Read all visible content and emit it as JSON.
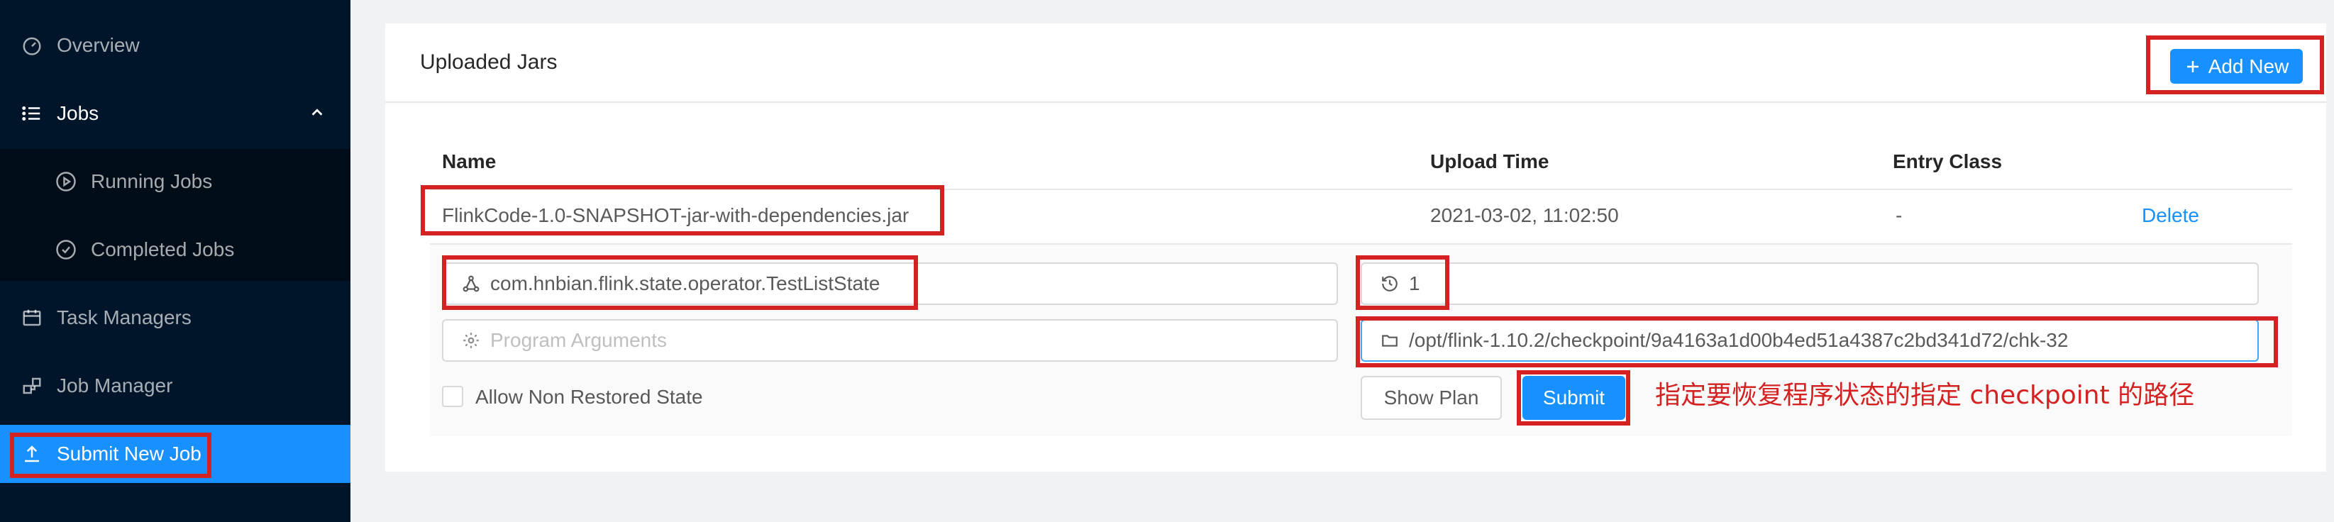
{
  "sidebar": {
    "items": [
      {
        "label": "Overview",
        "icon": "dashboard-icon"
      },
      {
        "label": "Jobs",
        "icon": "list-icon"
      },
      {
        "label": "Running Jobs",
        "icon": "play-circle-icon"
      },
      {
        "label": "Completed Jobs",
        "icon": "check-circle-icon"
      },
      {
        "label": "Task Managers",
        "icon": "schedule-icon"
      },
      {
        "label": "Job Manager",
        "icon": "build-icon"
      },
      {
        "label": "Submit New Job",
        "icon": "upload-icon"
      }
    ],
    "colors": {
      "bg": "#001529",
      "active": "#1890ff"
    }
  },
  "card": {
    "title": "Uploaded Jars",
    "add_label": "Add New"
  },
  "table": {
    "headers": [
      "Name",
      "Upload Time",
      "Entry Class"
    ],
    "rows": [
      {
        "name": "FlinkCode-1.0-SNAPSHOT-jar-with-dependencies.jar",
        "upload_time": "2021-03-02, 11:02:50",
        "entry_class": "-",
        "action": "Delete"
      }
    ]
  },
  "form": {
    "entry_class": "com.hnbian.flink.state.operator.TestListState",
    "parallelism": "1",
    "program_args_placeholder": "Program Arguments",
    "savepoint_path": "/opt/flink-1.10.2/checkpoint/9a4163a1d00b4ed51a4387c2bd341d72/chk-32",
    "allow_non_restored": "Allow Non Restored State",
    "show_plan": "Show Plan",
    "submit": "Submit"
  },
  "annotation": "指定要恢复程序状态的指定 checkpoint 的路径",
  "colors": {
    "highlight": "#d42121",
    "primary": "#1890ff"
  }
}
